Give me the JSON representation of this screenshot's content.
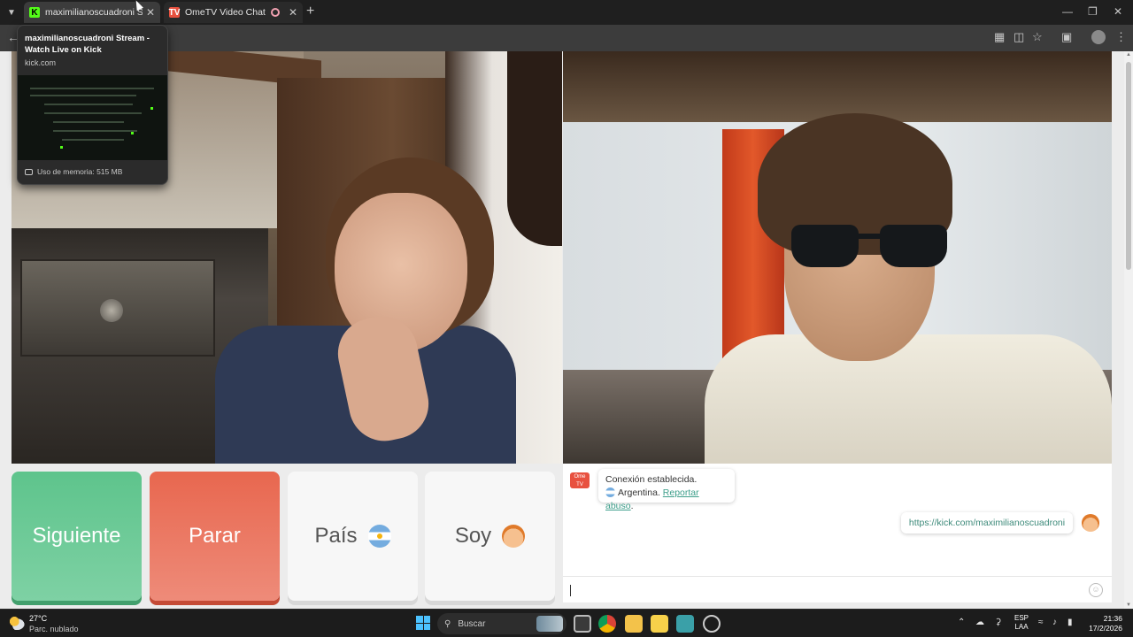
{
  "browser": {
    "tabs": [
      {
        "title": "maximilianoscuadroni Stream -",
        "favicon": "kick-icon"
      },
      {
        "title": "OmeTV Video Chat — Ome",
        "favicon": "ometv-icon"
      }
    ],
    "tooltip": {
      "title": "maximilianoscuadroni Stream - Watch Live on Kick",
      "url": "kick.com",
      "memory": "Uso de memoria: 515 MB"
    }
  },
  "page": {
    "buttons": {
      "next": "Siguiente",
      "stop": "Parar",
      "country": "País",
      "me": "Soy"
    },
    "chat": {
      "logo_text": "Ome TV",
      "system_line1": "Conexión establecida.",
      "country": "Argentina.",
      "report_link": "Reportar abuso",
      "report_suffix": ".",
      "user_message": "https://kick.com/maximilianoscuadroni"
    }
  },
  "taskbar": {
    "weather_temp": "27°C",
    "weather_desc": "Parc. nublado",
    "search_label": "Buscar",
    "lang_line1": "ESP",
    "lang_line2": "LAA",
    "time": "21:36",
    "date": "17/2/2026"
  },
  "colors": {
    "next_button": "#5ec48c",
    "stop_button": "#e8674f",
    "kick_green": "#53fc18",
    "link": "#3d9e8a"
  }
}
